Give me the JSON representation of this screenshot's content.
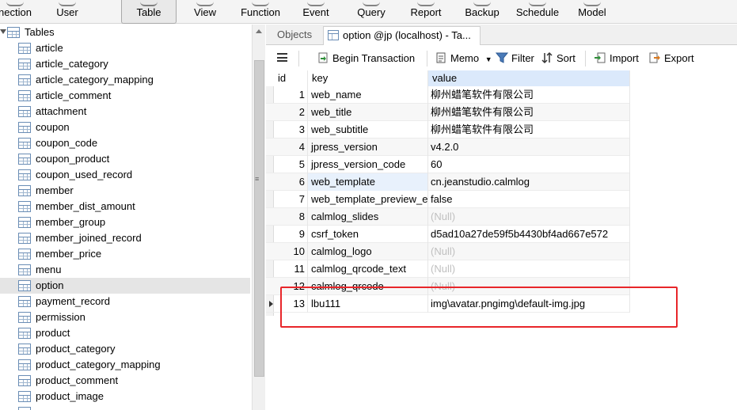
{
  "toolbar": {
    "buttons": [
      {
        "label": "nection",
        "icon": "connection-icon"
      },
      {
        "label": "User",
        "icon": "user-icon"
      },
      {
        "label": "Table",
        "icon": "table-icon",
        "active": true
      },
      {
        "label": "View",
        "icon": "view-icon"
      },
      {
        "label": "Function",
        "icon": "function-icon"
      },
      {
        "label": "Event",
        "icon": "event-icon"
      },
      {
        "label": "Query",
        "icon": "query-icon"
      },
      {
        "label": "Report",
        "icon": "report-icon"
      },
      {
        "label": "Backup",
        "icon": "backup-icon"
      },
      {
        "label": "Schedule",
        "icon": "schedule-icon"
      },
      {
        "label": "Model",
        "icon": "model-icon"
      }
    ]
  },
  "nav": {
    "root_label": "Tables",
    "tables": [
      "article",
      "article_category",
      "article_category_mapping",
      "article_comment",
      "attachment",
      "coupon",
      "coupon_code",
      "coupon_product",
      "coupon_used_record",
      "member",
      "member_dist_amount",
      "member_group",
      "member_joined_record",
      "member_price",
      "menu",
      "option",
      "payment_record",
      "permission",
      "product",
      "product_category",
      "product_category_mapping",
      "product_comment",
      "product_image"
    ],
    "selected": "option"
  },
  "tabs": {
    "objects": "Objects",
    "active": "option @jp (localhost) - Ta..."
  },
  "actions": {
    "begin_transaction": "Begin Transaction",
    "memo": "Memo",
    "filter": "Filter",
    "sort": "Sort",
    "import": "Import",
    "export": "Export"
  },
  "grid": {
    "columns": [
      "id",
      "key",
      "value"
    ],
    "null_text": "(Null)",
    "rows": [
      {
        "id": "1",
        "key": "web_name",
        "value": "柳州蜡笔软件有限公司",
        "null": false
      },
      {
        "id": "2",
        "key": "web_title",
        "value": "柳州蜡笔软件有限公司",
        "null": false
      },
      {
        "id": "3",
        "key": "web_subtitle",
        "value": "柳州蜡笔软件有限公司",
        "null": false
      },
      {
        "id": "4",
        "key": "jpress_version",
        "value": "v4.2.0",
        "null": false
      },
      {
        "id": "5",
        "key": "jpress_version_code",
        "value": "60",
        "null": false
      },
      {
        "id": "6",
        "key": "web_template",
        "value": "cn.jeanstudio.calmlog",
        "null": false
      },
      {
        "id": "7",
        "key": "web_template_preview_en",
        "value": "false",
        "null": false
      },
      {
        "id": "8",
        "key": "calmlog_slides",
        "value": "(Null)",
        "null": true
      },
      {
        "id": "9",
        "key": "csrf_token",
        "value": "d5ad10a27de59f5b4430bf4ad667e572",
        "null": false
      },
      {
        "id": "10",
        "key": "calmlog_logo",
        "value": "(Null)",
        "null": true
      },
      {
        "id": "11",
        "key": "calmlog_qrcode_text",
        "value": "(Null)",
        "null": true
      },
      {
        "id": "12",
        "key": "calmlog_qrcode",
        "value": "(Null)",
        "null": true
      },
      {
        "id": "13",
        "key": "lbu111",
        "value": "img\\avatar.pngimg\\default-img.jpg",
        "null": false
      }
    ]
  },
  "colors": {
    "highlight_box": "#e8262a",
    "value_header": "#dbe9fb",
    "selected_row": "#e5e5e5"
  }
}
